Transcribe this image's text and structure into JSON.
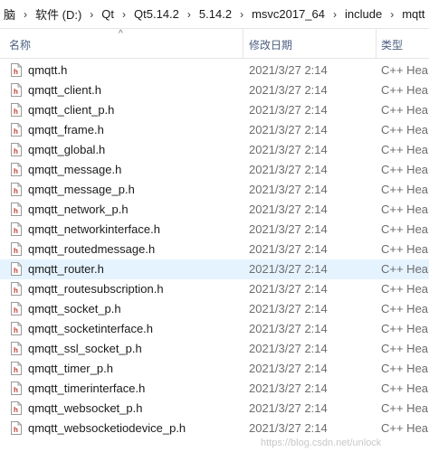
{
  "breadcrumb": [
    "脑",
    "软件 (D:)",
    "Qt",
    "Qt5.14.2",
    "5.14.2",
    "msvc2017_64",
    "include",
    "mqtt"
  ],
  "columns": {
    "name": "名称",
    "date": "修改日期",
    "type": "类型"
  },
  "files": [
    {
      "name": "qmqtt.h",
      "date": "2021/3/27 2:14",
      "type": "C++ Hea"
    },
    {
      "name": "qmqtt_client.h",
      "date": "2021/3/27 2:14",
      "type": "C++ Hea"
    },
    {
      "name": "qmqtt_client_p.h",
      "date": "2021/3/27 2:14",
      "type": "C++ Hea"
    },
    {
      "name": "qmqtt_frame.h",
      "date": "2021/3/27 2:14",
      "type": "C++ Hea"
    },
    {
      "name": "qmqtt_global.h",
      "date": "2021/3/27 2:14",
      "type": "C++ Hea"
    },
    {
      "name": "qmqtt_message.h",
      "date": "2021/3/27 2:14",
      "type": "C++ Hea"
    },
    {
      "name": "qmqtt_message_p.h",
      "date": "2021/3/27 2:14",
      "type": "C++ Hea"
    },
    {
      "name": "qmqtt_network_p.h",
      "date": "2021/3/27 2:14",
      "type": "C++ Hea"
    },
    {
      "name": "qmqtt_networkinterface.h",
      "date": "2021/3/27 2:14",
      "type": "C++ Hea"
    },
    {
      "name": "qmqtt_routedmessage.h",
      "date": "2021/3/27 2:14",
      "type": "C++ Hea"
    },
    {
      "name": "qmqtt_router.h",
      "date": "2021/3/27 2:14",
      "type": "C++ Hea",
      "selected": true
    },
    {
      "name": "qmqtt_routesubscription.h",
      "date": "2021/3/27 2:14",
      "type": "C++ Hea"
    },
    {
      "name": "qmqtt_socket_p.h",
      "date": "2021/3/27 2:14",
      "type": "C++ Hea"
    },
    {
      "name": "qmqtt_socketinterface.h",
      "date": "2021/3/27 2:14",
      "type": "C++ Hea"
    },
    {
      "name": "qmqtt_ssl_socket_p.h",
      "date": "2021/3/27 2:14",
      "type": "C++ Hea"
    },
    {
      "name": "qmqtt_timer_p.h",
      "date": "2021/3/27 2:14",
      "type": "C++ Hea"
    },
    {
      "name": "qmqtt_timerinterface.h",
      "date": "2021/3/27 2:14",
      "type": "C++ Hea"
    },
    {
      "name": "qmqtt_websocket_p.h",
      "date": "2021/3/27 2:14",
      "type": "C++ Hea"
    },
    {
      "name": "qmqtt_websocketiodevice_p.h",
      "date": "2021/3/27 2:14",
      "type": "C++ Hea"
    }
  ],
  "watermark": "https://blog.csdn.net/unlock"
}
